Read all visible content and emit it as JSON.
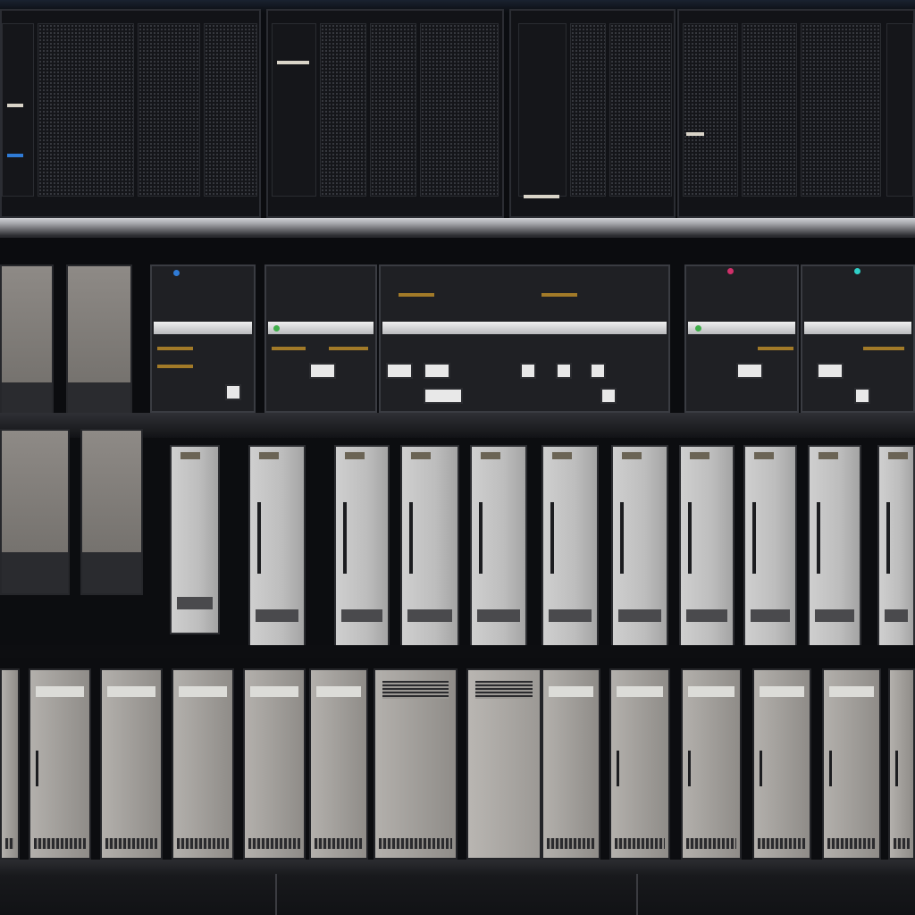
{
  "image": {
    "kind": "photo",
    "subject": "server-racks",
    "colors": {
      "background": "#0c0d10",
      "rack_dark": "#121317",
      "shelf_light": "#cfd0d4",
      "tower_gray": "#c4c4c4",
      "status_blue": "#2f7bd6",
      "status_green": "#3fae4a",
      "status_red": "#d0306a"
    },
    "sections": {
      "top_cabinets": 4,
      "switch_units": 7,
      "tower_servers": 12,
      "bottom_units": 14
    }
  }
}
